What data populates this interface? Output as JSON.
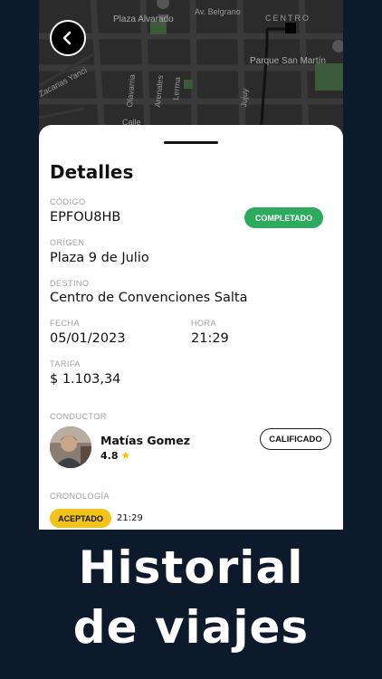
{
  "map": {
    "labels": {
      "plaza_alvarado": "Plaza Alvarado",
      "belgrano": "Av. Belgrano",
      "parque": "Parque San Martín",
      "centro": "CENTRO",
      "zacarias": "Zacarias Yanci",
      "olavarria": "Olavarria",
      "arenales": "Arenales",
      "lerma": "Lerma",
      "jujuy": "Jujuy",
      "calle": "Calle"
    }
  },
  "back_icon": "chevron-left-icon",
  "details": {
    "title": "Detalles",
    "code_label": "CÓDIGO",
    "code": "EPFOU8HB",
    "status": "COMPLETADO",
    "origin_label": "ORÍGEN",
    "origin": "Plaza 9 de Julio",
    "dest_label": "DESTINO",
    "destination": "Centro de Convenciones Salta",
    "date_label": "FECHA",
    "date": "05/01/2023",
    "time_label": "HORA",
    "time": "21:29",
    "fare_label": "TARIFA",
    "fare": "$ 1.103,34"
  },
  "driver": {
    "section_label": "CONDUCTOR",
    "name": "Matías Gomez",
    "rating": "4.8",
    "rated_button": "CALIFICADO"
  },
  "timeline": {
    "section_label": "CRONOLOGÍA",
    "status": "ACEPTADO",
    "time": "21:29"
  },
  "headline": {
    "line1": "Historial",
    "line2": "de viajes"
  },
  "colors": {
    "background": "#0d1a2b",
    "completed": "#2eaa5e",
    "accepted": "#f2c319",
    "star": "#f2c400"
  }
}
